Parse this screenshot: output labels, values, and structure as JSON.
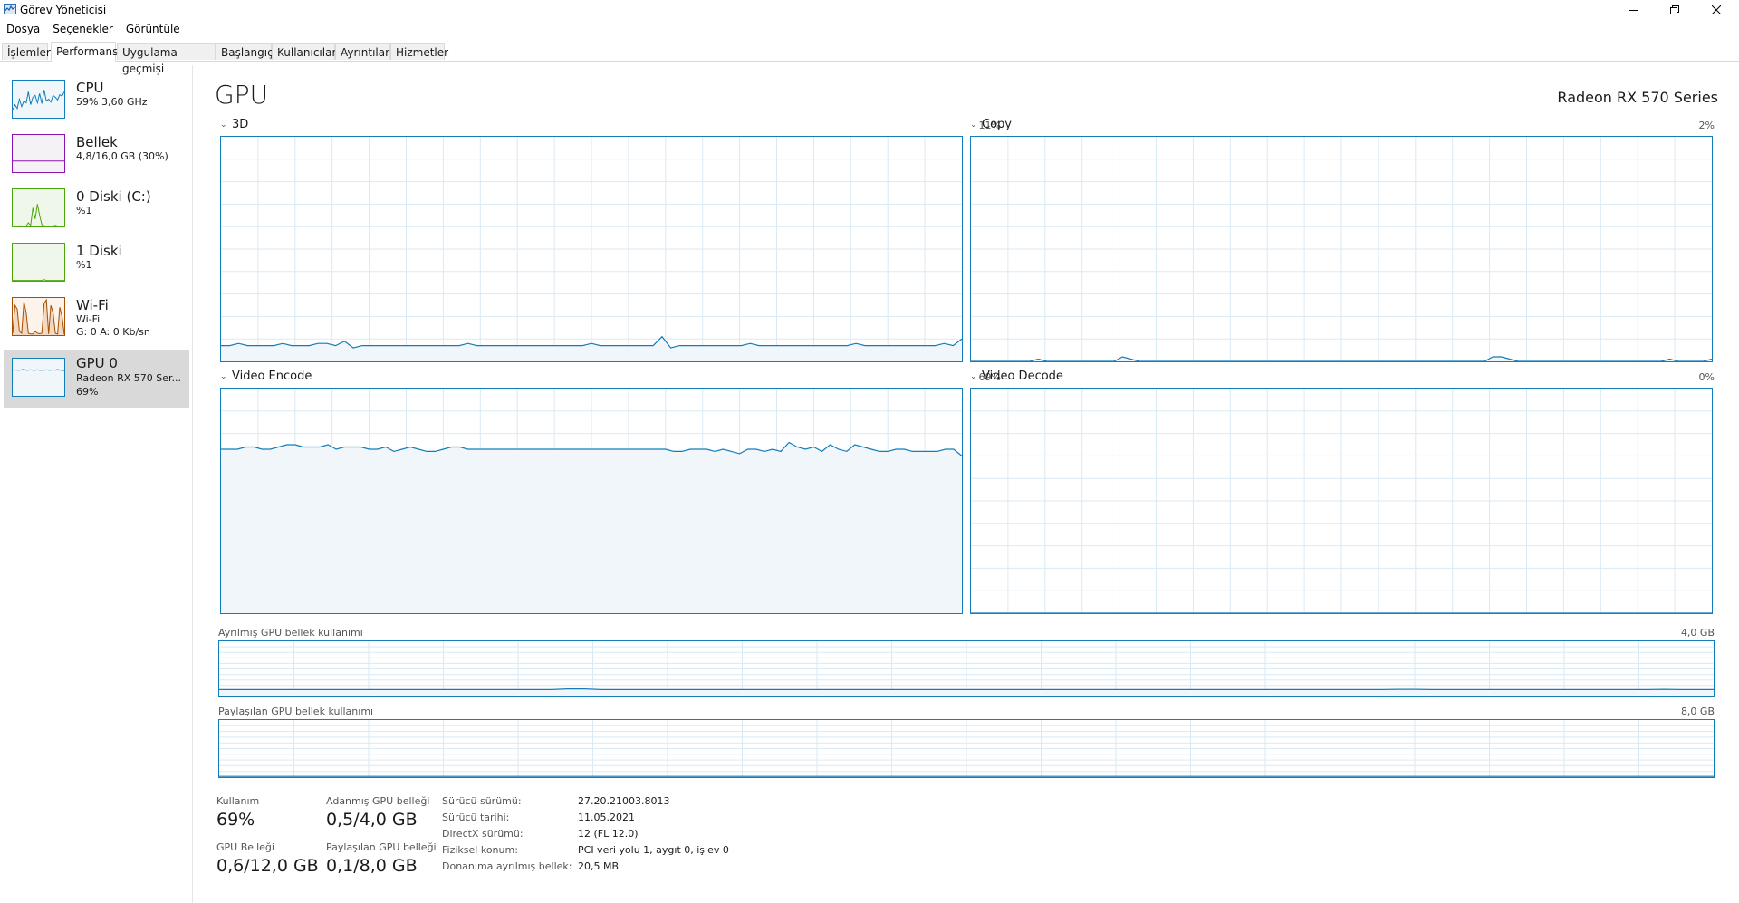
{
  "window": {
    "title": "Görev Yöneticisi",
    "controls": {
      "minimize": "minimize-icon",
      "restore": "restore-icon",
      "close": "close-icon"
    }
  },
  "menu": [
    "Dosya",
    "Seçenekler",
    "Görüntüle"
  ],
  "tabs": [
    {
      "label": "İşlemler",
      "active": false
    },
    {
      "label": "Performans",
      "active": true
    },
    {
      "label": "Uygulama geçmişi",
      "active": false
    },
    {
      "label": "Başlangıç",
      "active": false
    },
    {
      "label": "Kullanıcılar",
      "active": false
    },
    {
      "label": "Ayrıntılar",
      "active": false
    },
    {
      "label": "Hizmetler",
      "active": false
    }
  ],
  "sidebar": {
    "items": [
      {
        "title": "CPU",
        "line1": "59% 3,60 GHz",
        "line2": "",
        "color": "#117dbb",
        "fill": "#f1f6fa"
      },
      {
        "title": "Bellek",
        "line1": "4,8/16,0 GB (30%)",
        "line2": "",
        "color": "#8b12ae",
        "fill": "#f4f2f4"
      },
      {
        "title": "0 Diski (C:)",
        "line1": "%1",
        "line2": "",
        "color": "#4da60c",
        "fill": "#eff7ea"
      },
      {
        "title": "1 Diski",
        "line1": "%1",
        "line2": "",
        "color": "#4da60c",
        "fill": "#eff7ea"
      },
      {
        "title": "Wi-Fi",
        "line1": "Wi-Fi",
        "line2": "G: 0 A: 0 Kb/sn",
        "color": "#a74f01",
        "fill": "#fcf3eb"
      },
      {
        "title": "GPU 0",
        "line1": "Radeon RX 570 Ser...",
        "line2": "69%",
        "color": "#117dbb",
        "fill": "#f1f6fa",
        "active": true
      }
    ]
  },
  "main": {
    "title": "GPU",
    "model": "Radeon RX 570 Series",
    "graphs": {
      "g3d": {
        "label": "3D",
        "percent": "11%"
      },
      "copy": {
        "label": "Copy",
        "percent": "2%"
      },
      "encode": {
        "label": "Video Encode",
        "percent": "69%"
      },
      "decode": {
        "label": "Video Decode",
        "percent": "0%"
      }
    },
    "dedicated_mem": {
      "label": "Ayrılmış GPU bellek kullanımı",
      "max": "4,0 GB"
    },
    "shared_mem": {
      "label": "Paylaşılan GPU bellek kullanımı",
      "max": "8,0 GB"
    },
    "stats": {
      "usage_label": "Kullanım",
      "usage_value": "69%",
      "dedicated_label": "Adanmış GPU belleği",
      "dedicated_value": "0,5/4,0 GB",
      "gpu_mem_label": "GPU Belleği",
      "gpu_mem_value": "0,6/12,0 GB",
      "shared_label": "Paylaşılan GPU belleği",
      "shared_value": "0,1/8,0 GB"
    },
    "details": [
      {
        "key": "Sürücü sürümü:",
        "value": "27.20.21003.8013"
      },
      {
        "key": "Sürücü tarihi:",
        "value": "11.05.2021"
      },
      {
        "key": "DirectX sürümü:",
        "value": "12 (FL 12.0)"
      },
      {
        "key": "Fiziksel konum:",
        "value": "PCI veri yolu 1, aygıt 0, işlev 0"
      },
      {
        "key": "Donanıma ayrılmış bellek:",
        "value": "20,5 MB"
      }
    ]
  },
  "chart_data": [
    {
      "type": "area",
      "name": "3D",
      "ylim": [
        0,
        100
      ],
      "values": [
        7,
        7,
        8,
        7,
        7,
        7,
        7,
        8,
        7,
        7,
        7,
        8,
        8,
        7,
        9,
        6,
        7,
        7,
        7,
        7,
        7,
        7,
        7,
        7,
        7,
        7,
        7,
        7,
        8,
        7,
        7,
        7,
        7,
        7,
        7,
        7,
        7,
        7,
        7,
        7,
        7,
        7,
        8,
        7,
        7,
        7,
        7,
        7,
        7,
        7,
        11,
        6,
        7,
        7,
        7,
        7,
        7,
        7,
        7,
        7,
        8,
        7,
        7,
        7,
        7,
        7,
        7,
        7,
        7,
        7,
        7,
        7,
        8,
        7,
        7,
        7,
        7,
        7,
        7,
        7,
        7,
        7,
        8,
        7,
        10
      ]
    },
    {
      "type": "area",
      "name": "Copy",
      "ylim": [
        0,
        100
      ],
      "values": [
        0,
        0,
        0,
        0,
        0,
        0,
        0,
        0,
        1,
        0,
        0,
        0,
        0,
        0,
        0,
        0,
        0,
        0,
        2,
        1,
        0,
        0,
        0,
        0,
        0,
        0,
        0,
        0,
        0,
        0,
        0,
        0,
        0,
        0,
        0,
        0,
        0,
        0,
        0,
        0,
        0,
        0,
        0,
        0,
        0,
        0,
        0,
        0,
        0,
        0,
        0,
        0,
        0,
        0,
        0,
        0,
        0,
        0,
        0,
        0,
        0,
        0,
        2,
        2,
        1,
        0,
        0,
        0,
        0,
        0,
        0,
        0,
        0,
        0,
        0,
        0,
        0,
        0,
        0,
        0,
        0,
        0,
        0,
        1,
        0,
        0,
        0,
        0,
        1
      ]
    },
    {
      "type": "area",
      "name": "Video Encode",
      "ylim": [
        0,
        100
      ],
      "values": [
        73,
        73,
        73,
        74,
        74,
        73,
        73,
        74,
        75,
        75,
        74,
        74,
        74,
        75,
        73,
        74,
        74,
        74,
        73,
        73,
        74,
        72,
        73,
        74,
        73,
        72,
        72,
        73,
        74,
        74,
        73,
        73,
        73,
        73,
        73,
        73,
        73,
        73,
        73,
        73,
        73,
        73,
        73,
        73,
        73,
        73,
        73,
        73,
        73,
        73,
        73,
        73,
        73,
        73,
        73,
        72,
        72,
        73,
        73,
        73,
        72,
        73,
        72,
        71,
        73,
        73,
        72,
        73,
        72,
        76,
        74,
        73,
        74,
        72,
        75,
        73,
        72,
        75,
        74,
        73,
        72,
        72,
        73,
        73,
        72,
        72,
        72,
        72,
        73,
        73,
        70
      ]
    },
    {
      "type": "area",
      "name": "Video Decode",
      "ylim": [
        0,
        100
      ],
      "values": [
        0,
        0,
        0,
        0,
        0,
        0,
        0,
        0,
        0,
        0,
        0,
        0,
        0,
        0,
        0,
        0,
        0,
        0,
        0,
        0,
        0,
        0,
        0,
        0,
        0,
        0,
        0,
        0,
        0,
        0,
        0,
        0,
        0,
        0,
        0,
        0,
        0,
        0,
        0,
        0,
        0,
        0,
        0,
        0,
        0,
        0,
        0,
        0,
        0,
        0,
        0,
        0,
        0,
        0,
        0,
        0,
        0,
        0,
        0,
        0,
        0,
        0,
        0,
        0,
        0,
        0,
        0,
        0,
        0,
        0,
        0,
        0,
        0,
        0,
        0,
        0,
        0,
        0,
        0,
        0
      ]
    },
    {
      "type": "area",
      "name": "Ayrılmış GPU bellek kullanımı",
      "ylim": [
        0,
        4.0
      ],
      "values": [
        0.5,
        0.5,
        0.5,
        0.5,
        0.5,
        0.5,
        0.5,
        0.5,
        0.5,
        0.5,
        0.5,
        0.5,
        0.5,
        0.5,
        0.5,
        0.5,
        0.5,
        0.5,
        0.5,
        0.5,
        0.5,
        0.55,
        0.55,
        0.5,
        0.5,
        0.5,
        0.5,
        0.5,
        0.5,
        0.5,
        0.5,
        0.5,
        0.5,
        0.5,
        0.5,
        0.5,
        0.5,
        0.5,
        0.5,
        0.5,
        0.5,
        0.5,
        0.5,
        0.5,
        0.5,
        0.5,
        0.5,
        0.5,
        0.5,
        0.5,
        0.5,
        0.5,
        0.5,
        0.5,
        0.5,
        0.5,
        0.5,
        0.5,
        0.5,
        0.5,
        0.5,
        0.5,
        0.5,
        0.5,
        0.5,
        0.5,
        0.5,
        0.5,
        0.5,
        0.5,
        0.5,
        0.52,
        0.52,
        0.5,
        0.5,
        0.5,
        0.5,
        0.5,
        0.5,
        0.5,
        0.5,
        0.5,
        0.5,
        0.5,
        0.5,
        0.5,
        0.5,
        0.52,
        0.5,
        0.5,
        0.5
      ]
    },
    {
      "type": "area",
      "name": "Paylaşılan GPU bellek kullanımı",
      "ylim": [
        0,
        8.0
      ],
      "values": [
        0.1,
        0.1,
        0.1,
        0.1,
        0.1,
        0.1,
        0.1,
        0.1,
        0.1,
        0.1,
        0.1,
        0.1,
        0.1,
        0.1,
        0.1,
        0.1,
        0.1,
        0.1,
        0.1,
        0.1,
        0.1,
        0.1,
        0.1,
        0.1,
        0.1,
        0.1,
        0.1,
        0.1,
        0.1,
        0.1,
        0.1,
        0.1,
        0.1,
        0.1,
        0.1,
        0.1,
        0.1,
        0.1,
        0.1,
        0.1,
        0.1,
        0.1,
        0.1,
        0.1,
        0.1,
        0.1,
        0.1,
        0.1,
        0.1,
        0.1
      ]
    }
  ],
  "thumbnails": {
    "CPU": [
      20,
      35,
      25,
      50,
      30,
      45,
      40,
      70,
      35,
      55,
      60,
      40,
      65,
      38,
      75,
      45,
      50,
      42,
      60,
      55,
      48,
      62,
      58,
      70
    ],
    "Bellek": [
      30,
      30,
      30,
      30,
      30,
      30,
      30,
      30,
      30,
      30,
      30,
      30,
      30,
      30,
      30,
      30,
      30,
      30,
      30,
      30,
      30,
      30,
      30,
      30
    ],
    "0 Diski (C:)": [
      1,
      1,
      1,
      2,
      1,
      1,
      1,
      10,
      3,
      50,
      20,
      60,
      30,
      5,
      2,
      1,
      1,
      1,
      1,
      3,
      1,
      1,
      1,
      1
    ],
    "1 Diski": [
      1,
      1,
      1,
      1,
      1,
      1,
      1,
      1,
      1,
      1,
      1,
      1,
      1,
      1,
      3,
      1,
      1,
      1,
      1,
      1,
      1,
      1,
      1,
      1
    ],
    "Wi-Fi": [
      5,
      80,
      70,
      10,
      5,
      90,
      60,
      5,
      3,
      3,
      10,
      5,
      4,
      5,
      85,
      95,
      3,
      80,
      60,
      5,
      3,
      75,
      50,
      2
    ],
    "GPU 0": [
      69,
      70,
      69,
      69,
      70,
      71,
      69,
      69,
      70,
      69,
      69,
      70,
      69,
      69,
      69,
      70,
      69,
      69,
      70,
      69,
      71,
      69,
      69,
      68
    ]
  }
}
